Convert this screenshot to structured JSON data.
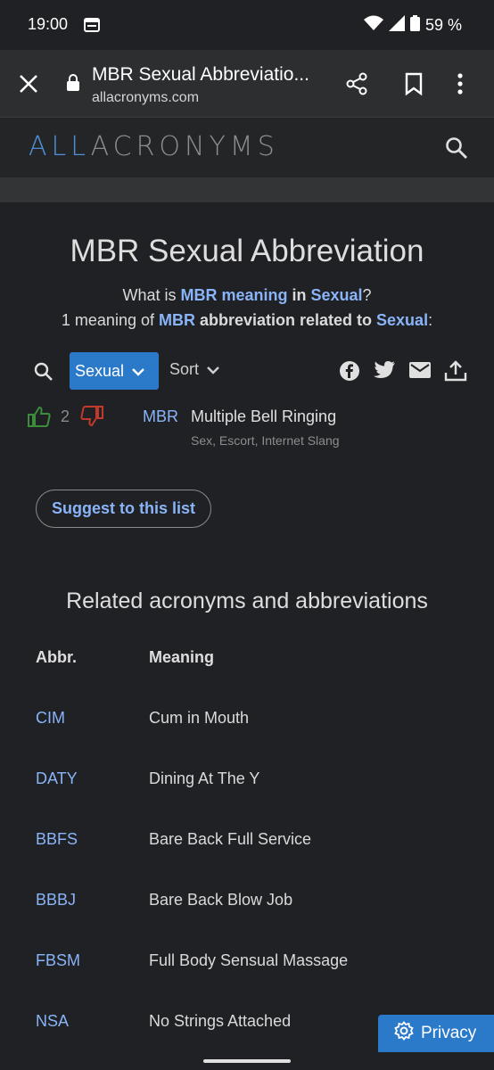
{
  "status": {
    "time": "19:00",
    "battery": "59 %"
  },
  "browser": {
    "title": "MBR Sexual Abbreviatio...",
    "url": "allacronyms.com"
  },
  "site": {
    "logo_all": "ALL",
    "logo_rest": "ACRONYMS"
  },
  "page": {
    "title": "MBR Sexual Abbreviation",
    "sub1": {
      "pre": "What is ",
      "abbr": "MBR meaning",
      "mid": " in ",
      "cat": "Sexual",
      "post": "?"
    },
    "sub2": {
      "pre": "1 meaning of ",
      "abbr": "MBR",
      "mid": " abbreviation related to ",
      "cat": "Sexual",
      "post": ":"
    }
  },
  "toolbar": {
    "category": "Sexual",
    "sort": "Sort"
  },
  "entry": {
    "votes": "2",
    "abbr": "MBR",
    "meaning": "Multiple Bell Ringing",
    "tags": "Sex, Escort, Internet Slang"
  },
  "suggest_label": "Suggest to this list",
  "related": {
    "title": "Related acronyms and abbreviations",
    "col_abbr": "Abbr.",
    "col_meaning": "Meaning",
    "rows": [
      {
        "abbr": "CIM",
        "meaning": "Cum in Mouth"
      },
      {
        "abbr": "DATY",
        "meaning": "Dining At The Y"
      },
      {
        "abbr": "BBFS",
        "meaning": "Bare Back Full Service"
      },
      {
        "abbr": "BBBJ",
        "meaning": "Bare Back Blow Job"
      },
      {
        "abbr": "FBSM",
        "meaning": "Full Body Sensual Massage"
      },
      {
        "abbr": "NSA",
        "meaning": "No Strings Attached"
      }
    ]
  },
  "privacy_label": "Privacy",
  "colors": {
    "accent": "#2b79c9",
    "link": "#8ab4f8",
    "vote_up": "#3c8c3c",
    "vote_down": "#c0392b"
  }
}
